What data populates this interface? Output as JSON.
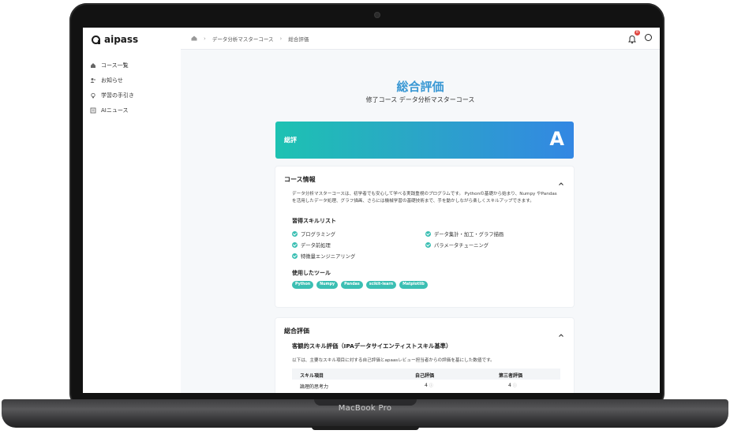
{
  "device": {
    "brand_label": "MacBook Pro"
  },
  "app": {
    "logo_text": "aipass",
    "sidebar": {
      "items": [
        {
          "label": "コース一覧",
          "icon": "home-icon"
        },
        {
          "label": "お知らせ",
          "icon": "users-icon"
        },
        {
          "label": "学習の手引き",
          "icon": "lightbulb-icon"
        },
        {
          "label": "AIニュース",
          "icon": "newspaper-icon"
        }
      ]
    },
    "topbar": {
      "breadcrumbs": [
        "データ分析マスターコース",
        "総合評価"
      ],
      "notification_count": "8"
    }
  },
  "page": {
    "title": "総合評価",
    "subtitle": "修了コース データ分析マスターコース",
    "grade_card": {
      "label": "総評",
      "grade": "A"
    },
    "course_info": {
      "heading": "コース情報",
      "description": "データ分析マスターコースは、初学者でも安心して学べる実践重視のプログラムです。 Pythonの基礎から始まり、Numpy やPandasを活用したデータ処理、グラフ描画、さらには機械学習の基礎技術まで、手を動かしながら楽しくスキルアップできます。",
      "skills_heading": "習得スキルリスト",
      "skills": [
        "プログラミング",
        "データ集計・加工・グラフ描画",
        "データ前処理",
        "パラメータチューニング",
        "特徴量エンジニアリング"
      ],
      "tools_heading": "使用したツール",
      "tools": [
        "Python",
        "Numpy",
        "Pandas",
        "scikit-learn",
        "Matplotlib"
      ]
    },
    "evaluation": {
      "heading": "総合評価",
      "subheading": "客観的スキル評価（IPAデータサイエンティストスキル基準）",
      "description": "以下は、主要なスキル項目に対する自己評価とapaasレビュー担当者からの評価を基にした数値です。",
      "columns": [
        "スキル項目",
        "自己評価",
        "第三者評価"
      ],
      "rows": [
        {
          "item": "論理的思考力",
          "self": "4",
          "third": "4"
        }
      ]
    }
  },
  "colors": {
    "title_blue": "#3a98d4",
    "gradient_start": "#1dc2b2",
    "gradient_end": "#3387e3",
    "accent_teal": "#3bbfb3"
  }
}
